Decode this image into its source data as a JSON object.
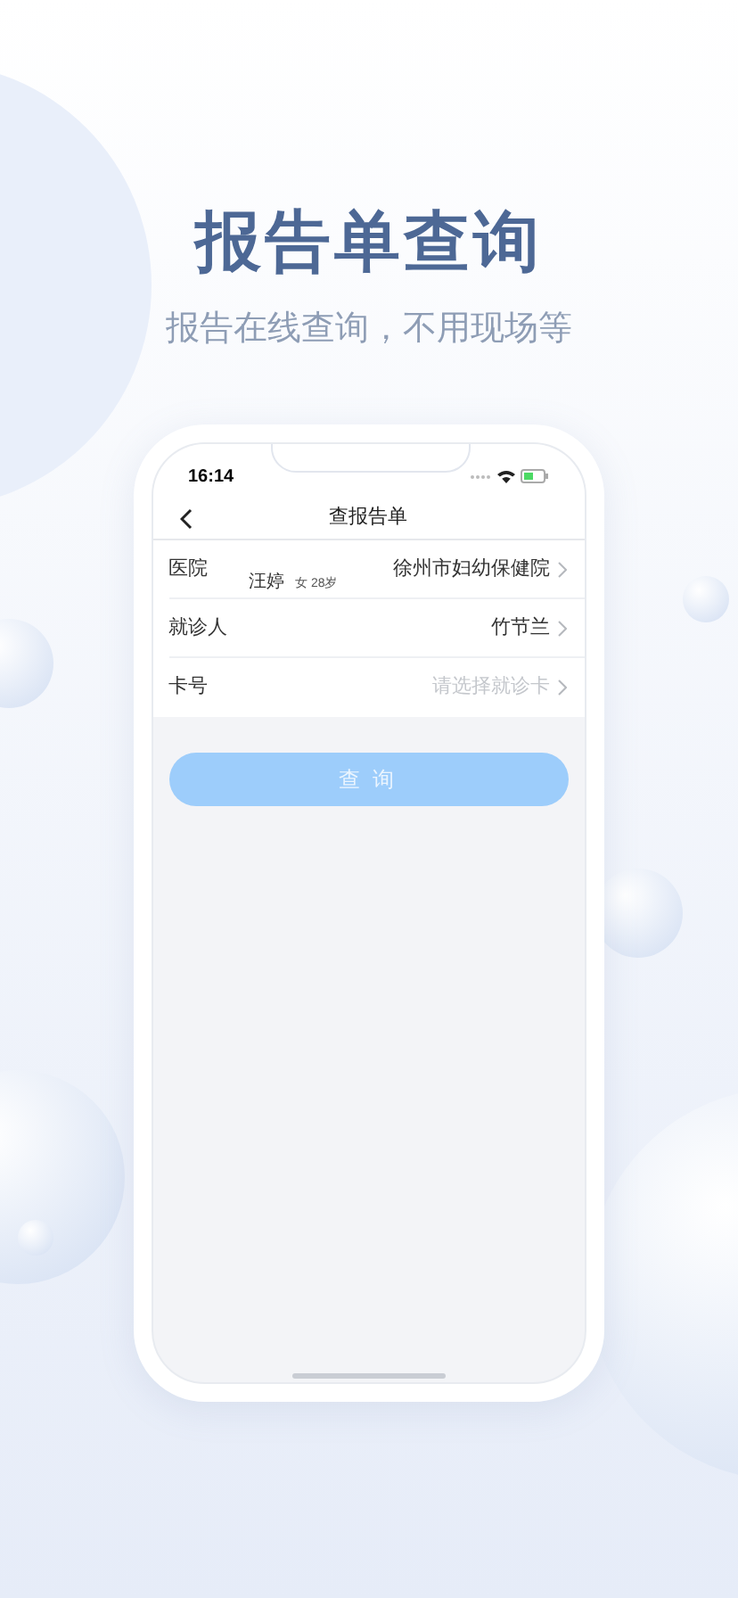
{
  "headline": "报告单查询",
  "subheadline": "报告在线查询，不用现场等",
  "status_bar": {
    "time": "16:14"
  },
  "nav": {
    "title": "查报告单"
  },
  "form": {
    "rows": [
      {
        "label": "医院",
        "value": "徐州市妇幼保健院",
        "kind": "value",
        "overlay": {
          "name": "汪婷",
          "info": "女 28岁"
        }
      },
      {
        "label": "就诊人",
        "value": "竹节兰",
        "kind": "value"
      },
      {
        "label": "卡号",
        "value": "请选择就诊卡",
        "kind": "placeholder"
      }
    ]
  },
  "button": {
    "label": "查 询",
    "disabled": true
  }
}
